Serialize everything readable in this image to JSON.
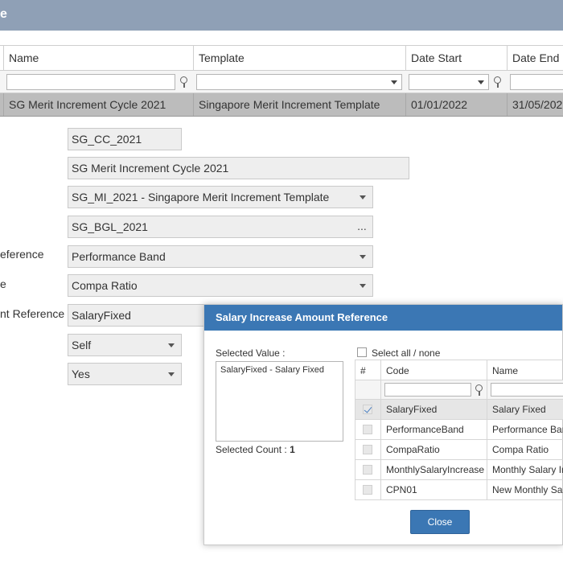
{
  "window": {
    "title_fragment": "e"
  },
  "grid": {
    "columns": [
      "Name",
      "Template",
      "Date Start",
      "Date End"
    ],
    "row": {
      "name": "SG Merit Increment Cycle 2021",
      "template": "Singapore Merit Increment Template",
      "date_start": "01/01/2022",
      "date_end": "31/05/202"
    }
  },
  "form": {
    "code": "SG_CC_2021",
    "name": "SG Merit Increment Cycle 2021",
    "template": "SG_MI_2021 - Singapore Merit Increment Template",
    "budget": "SG_BGL_2021",
    "budget_button": "...",
    "label_performance_reference": "eference",
    "performance_reference": "Performance Band",
    "label_compa": "e",
    "compa": "Compa Ratio",
    "label_amount_reference": "nt Reference",
    "amount_reference": "SalaryFixed",
    "approver": "Self",
    "flag": "Yes"
  },
  "dialog": {
    "title": "Salary Increase Amount Reference",
    "selected_value_label": "Selected Value :",
    "selected_value": "SalaryFixed - Salary Fixed",
    "selected_count_label": "Selected Count :",
    "selected_count": "1",
    "select_all_label": "Select all / none",
    "table": {
      "headers": [
        "#",
        "Code",
        "Name"
      ],
      "rows": [
        {
          "code": "SalaryFixed",
          "name": "Salary Fixed",
          "checked": true
        },
        {
          "code": "PerformanceBand",
          "name": "Performance Band",
          "checked": false
        },
        {
          "code": "CompaRatio",
          "name": "Compa Ratio",
          "checked": false
        },
        {
          "code": "MonthlySalaryIncrease",
          "name": "Monthly Salary Increase",
          "checked": false
        },
        {
          "code": "CPN01",
          "name": "New Monthly Salary",
          "checked": false
        }
      ]
    },
    "close_label": "Close"
  },
  "colors": {
    "titlebar": "#8fa0b6",
    "dialog_header": "#3b77b4",
    "selected_row": "#bcbcbc"
  }
}
